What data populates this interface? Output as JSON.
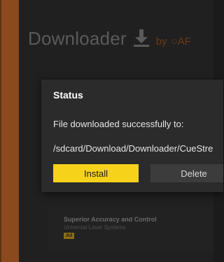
{
  "app": {
    "title": "Downloader",
    "by": "by",
    "brand": "○AF"
  },
  "dialog": {
    "title": "Status",
    "message": "File downloaded successfully to:",
    "path": "/sdcard/Download/Downloader/CueStre",
    "install_label": "Install",
    "delete_label": "Delete",
    "third_label": ""
  },
  "ad": {
    "title": "Superior Accuracy and Control",
    "subtitle": "Universal Laser Systems",
    "badge": "Ad"
  },
  "colors": {
    "accent": "#f6d21b",
    "brand": "#6b3a16",
    "side_strip": "#8a4a1e",
    "dialog_bg": "#2b2b2b",
    "background": "#202020"
  },
  "icons": {
    "download": "download-arrow-icon"
  }
}
